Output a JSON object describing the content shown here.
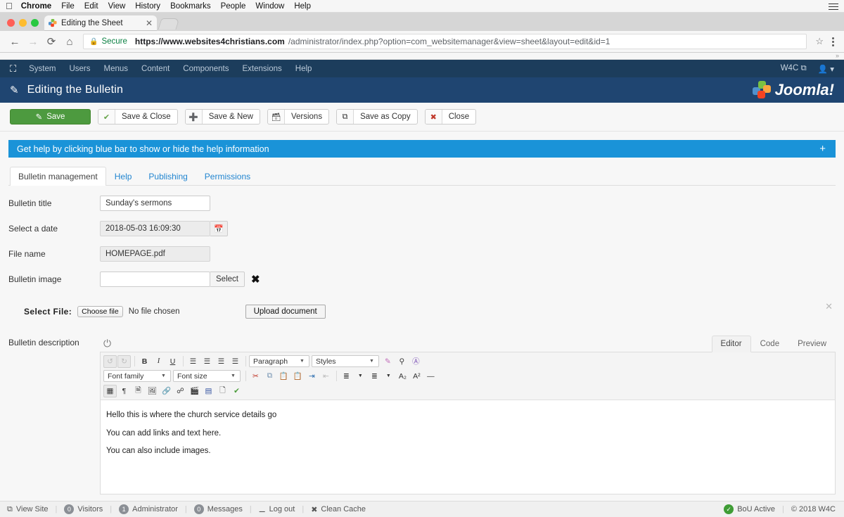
{
  "mac_menu": {
    "apple_icon": "apple-icon",
    "items": [
      "Chrome",
      "File",
      "Edit",
      "View",
      "History",
      "Bookmarks",
      "People",
      "Window",
      "Help"
    ],
    "right_icon": "list-menu-icon"
  },
  "browser": {
    "tab": {
      "title": "Editing the Sheet",
      "favicon": "joomla-favicon",
      "close_icon": "close-icon"
    },
    "new_tab_icon": "new-tab-icon",
    "nav": {
      "back_icon": "back-arrow-icon",
      "forward_icon": "forward-arrow-icon",
      "reload_icon": "reload-icon",
      "home_icon": "home-icon"
    },
    "omnibox": {
      "lock_icon": "lock-icon",
      "secure_label": "Secure",
      "url_host": "https://www.websites4christians.com",
      "url_path": "/administrator/index.php?option=com_websitemanager&view=sheet&layout=edit&id=1",
      "bookmark_icon": "star-icon",
      "menu_icon": "kebab-menu-icon"
    },
    "overflow_chevron": "»"
  },
  "admin_menu": {
    "logo_icon": "joomla-logo-icon",
    "items": [
      "System",
      "Users",
      "Menus",
      "Content",
      "Components",
      "Extensions",
      "Help"
    ],
    "site_label": "W4C",
    "site_external_icon": "external-link-icon",
    "user_icon": "user-icon",
    "user_caret": "▾"
  },
  "page_header": {
    "pencil_icon": "pencil-icon",
    "title": "Editing the Bulletin",
    "brand_text": "Joomla!",
    "brand_mark_icon": "joomla-brand-icon"
  },
  "toolbar": {
    "buttons": [
      {
        "label": "Save",
        "icon": "save-icon",
        "style": "primary"
      },
      {
        "label": "Save & Close",
        "icon": "check-icon",
        "style": "default"
      },
      {
        "label": "Save & New",
        "icon": "plus-icon",
        "style": "default"
      },
      {
        "label": "Versions",
        "icon": "archive-icon",
        "style": "default"
      },
      {
        "label": "Save as Copy",
        "icon": "copy-icon",
        "style": "default"
      },
      {
        "label": "Close",
        "icon": "cancel-icon",
        "style": "default"
      }
    ]
  },
  "help_bar": {
    "text": "Get help by clicking blue bar to show or hide the help information",
    "toggle_label": "+",
    "color": "#1a93d8"
  },
  "tabs": [
    {
      "label": "Bulletin management",
      "active": true
    },
    {
      "label": "Help",
      "active": false
    },
    {
      "label": "Publishing",
      "active": false
    },
    {
      "label": "Permissions",
      "active": false
    }
  ],
  "form": {
    "bulletin_title": {
      "label": "Bulletin title",
      "value": "Sunday's sermons",
      "placeholder": ""
    },
    "select_date": {
      "label": "Select a date",
      "value": "2018-05-03 16:09:30",
      "calendar_icon": "calendar-icon"
    },
    "file_name": {
      "label": "File name",
      "value": "HOMEPAGE.pdf"
    },
    "bulletin_image": {
      "label": "Bulletin image",
      "value": "",
      "placeholder": "",
      "select_label": "Select",
      "clear_icon": "clear-x-icon"
    }
  },
  "upload": {
    "label": "Select File:",
    "choose_button": "Choose file",
    "status": "No file chosen",
    "upload_button": "Upload document",
    "dismiss_icon": "close-icon"
  },
  "editor": {
    "label": "Bulletin description",
    "power_icon": "power-toggle-icon",
    "view_tabs": [
      {
        "label": "Editor",
        "active": true
      },
      {
        "label": "Code",
        "active": false
      },
      {
        "label": "Preview",
        "active": false
      }
    ],
    "toolbar_row1": [
      {
        "icon": "undo-icon",
        "glyph": "↺",
        "state": "disabled"
      },
      {
        "icon": "redo-icon",
        "glyph": "↻",
        "state": "disabled"
      },
      {
        "sep": true
      },
      {
        "icon": "bold-icon",
        "glyph": "B",
        "state": "normal"
      },
      {
        "icon": "italic-icon",
        "glyph": "I",
        "state": "normal"
      },
      {
        "icon": "underline-icon",
        "glyph": "U",
        "state": "normal"
      },
      {
        "sep": true
      },
      {
        "icon": "align-left-icon",
        "glyph": "≡",
        "state": "normal"
      },
      {
        "icon": "align-center-icon",
        "glyph": "≡",
        "state": "normal"
      },
      {
        "icon": "align-right-icon",
        "glyph": "≡",
        "state": "normal"
      },
      {
        "icon": "align-justify-icon",
        "glyph": "≡",
        "state": "normal"
      }
    ],
    "paragraph_select": {
      "label": "Paragraph",
      "caret": "▼"
    },
    "styles_select": {
      "label": "Styles",
      "caret": "▼"
    },
    "toolbar_row1_end": [
      {
        "icon": "remove-format-icon",
        "glyph": "🖊",
        "state": "normal"
      },
      {
        "icon": "find-replace-icon",
        "glyph": "🔍",
        "state": "normal"
      },
      {
        "icon": "spellcheck-icon",
        "glyph": "A",
        "state": "normal"
      }
    ],
    "font_family_select": {
      "label": "Font family",
      "caret": "▼"
    },
    "font_size_select": {
      "label": "Font size",
      "caret": "▼"
    },
    "toolbar_row2": [
      {
        "icon": "cut-icon",
        "glyph": "✂",
        "state": "normal"
      },
      {
        "icon": "copy-icon",
        "glyph": "⧉",
        "state": "normal"
      },
      {
        "icon": "paste-icon",
        "glyph": "📋",
        "state": "normal"
      },
      {
        "icon": "paste-text-icon",
        "glyph": "📋",
        "state": "normal"
      },
      {
        "icon": "indent-increase-icon",
        "glyph": "⇥",
        "state": "normal"
      },
      {
        "icon": "indent-decrease-icon",
        "glyph": "⇤",
        "state": "disabled"
      },
      {
        "sep": true
      },
      {
        "icon": "numbered-list-icon",
        "glyph": "≔",
        "state": "normal"
      },
      {
        "icon": "numbered-list-caret-icon",
        "glyph": "▼",
        "state": "normal"
      },
      {
        "icon": "bullet-list-icon",
        "glyph": "≔",
        "state": "normal"
      },
      {
        "icon": "bullet-list-caret-icon",
        "glyph": "▼",
        "state": "normal"
      },
      {
        "icon": "subscript-icon",
        "glyph": "A₂",
        "state": "normal"
      },
      {
        "icon": "superscript-icon",
        "glyph": "A²",
        "state": "normal"
      },
      {
        "icon": "horizontal-rule-icon",
        "glyph": "—",
        "state": "normal"
      }
    ],
    "toolbar_row3": [
      {
        "icon": "table-icon",
        "glyph": "▦",
        "state": "active"
      },
      {
        "icon": "paragraph-marks-icon",
        "glyph": "¶",
        "state": "normal"
      },
      {
        "icon": "page-break-icon",
        "glyph": "🗎",
        "state": "normal"
      },
      {
        "icon": "insert-image-icon",
        "glyph": "🖼",
        "state": "normal"
      },
      {
        "icon": "link-icon",
        "glyph": "🔗",
        "state": "disabled"
      },
      {
        "icon": "unlink-icon",
        "glyph": "⛓",
        "state": "normal"
      },
      {
        "icon": "media-icon",
        "glyph": "🎬",
        "state": "normal"
      },
      {
        "icon": "module-icon",
        "glyph": "▤",
        "state": "normal"
      },
      {
        "icon": "article-icon",
        "glyph": "🗋",
        "state": "normal"
      },
      {
        "icon": "template-icon",
        "glyph": "✔",
        "state": "normal"
      }
    ],
    "content_paragraphs": [
      "Hello this is where the church service details go",
      "You can add links and text here.",
      "You can also include images."
    ]
  },
  "status_bar": {
    "view_site": {
      "label": "View Site",
      "icon": "external-link-icon"
    },
    "visitors": {
      "label": "Visitors",
      "count": "0"
    },
    "administrator": {
      "label": "Administrator",
      "count": "1"
    },
    "messages": {
      "label": "Messages",
      "count": "0"
    },
    "logout": {
      "label": "Log out",
      "icon": "logout-icon"
    },
    "clean_cache": {
      "label": "Clean Cache",
      "icon": "broom-icon"
    },
    "bou": {
      "label": "BoU Active",
      "icon": "status-ok-icon"
    },
    "copyright": "© 2018 W4C"
  }
}
